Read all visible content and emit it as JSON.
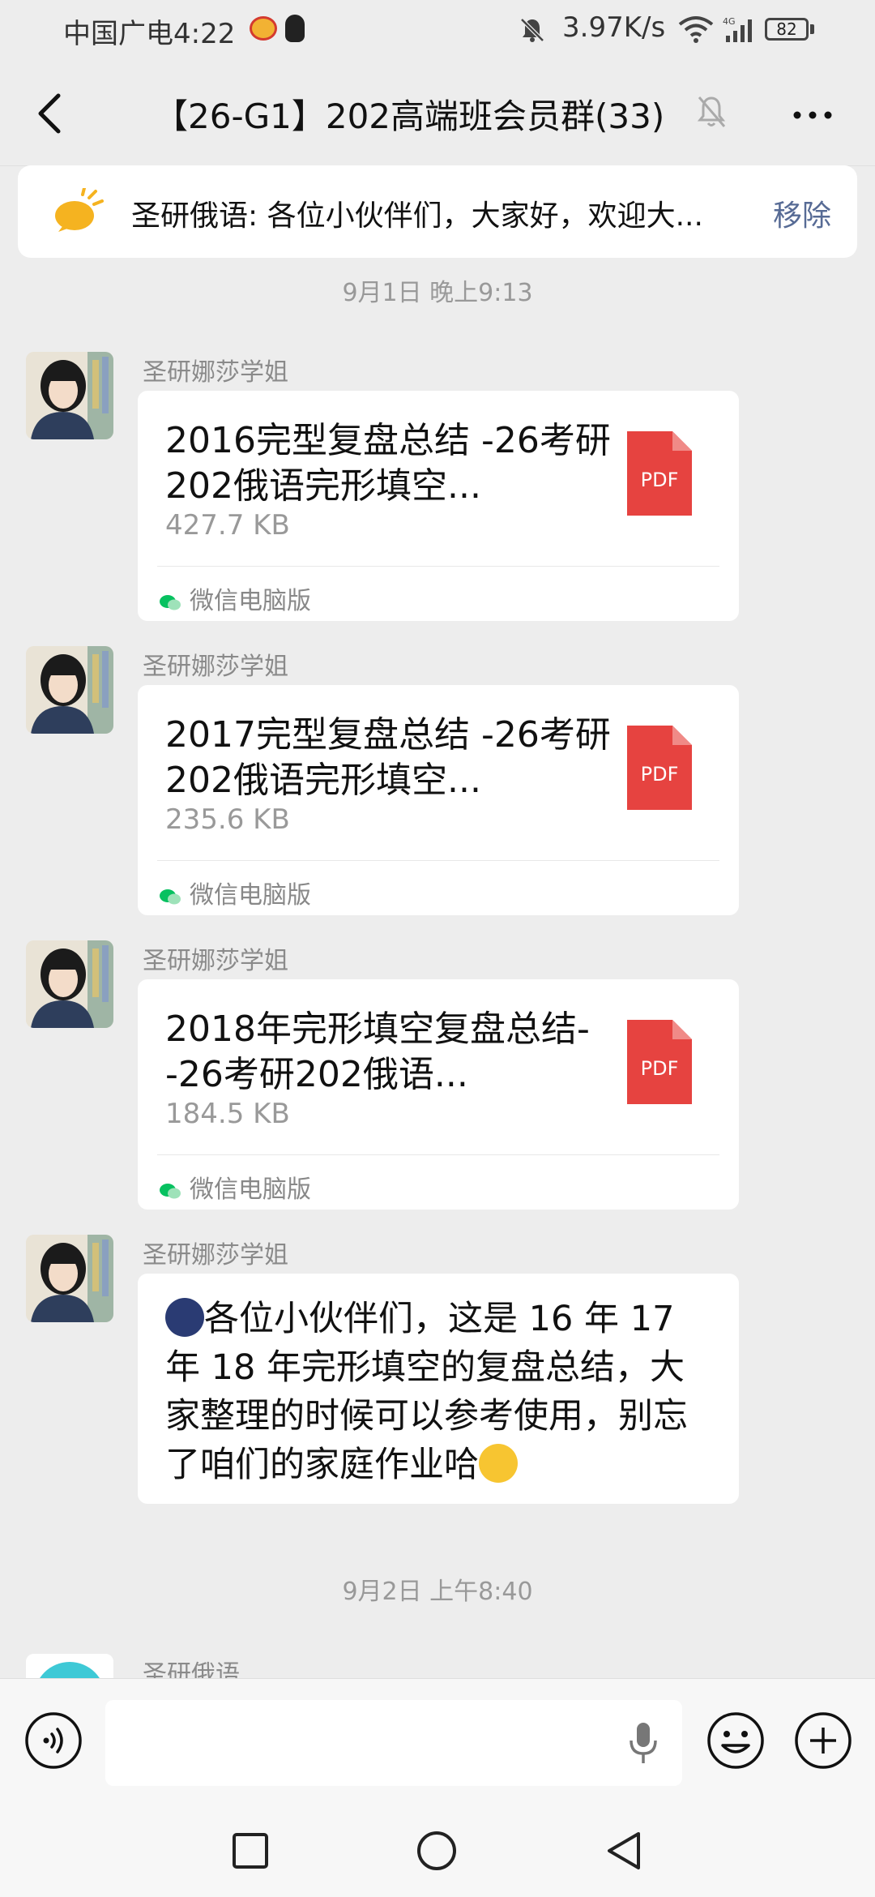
{
  "status_bar": {
    "carrier_time": "中国广电4:22",
    "net_speed": "3.97K/s",
    "battery": "82",
    "network_type": "4G"
  },
  "header": {
    "title": "【26-G1】202高端班会员群(33)",
    "back_icon": "back-chevron-icon",
    "mute_icon": "bell-muted-icon",
    "more_icon": "more-dots-icon"
  },
  "notice": {
    "text": "圣研俄语: 各位小伙伴们，大家好，欢迎大...",
    "remove_label": "移除"
  },
  "timestamps": {
    "first": "9月1日 晚上9:13",
    "second": "9月2日 上午8:40"
  },
  "messages": [
    {
      "sender": "圣研娜莎学姐",
      "file_name": "2016完型复盘总结 -26考研202俄语完形填空...",
      "file_size": "427.7 KB",
      "file_type": "PDF",
      "source": "微信电脑版"
    },
    {
      "sender": "圣研娜莎学姐",
      "file_name": "2017完型复盘总结 -26考研202俄语完形填空...",
      "file_size": "235.6 KB",
      "file_type": "PDF",
      "source": "微信电脑版"
    },
    {
      "sender": "圣研娜莎学姐",
      "file_name": "2018年完形填空复盘总结- -26考研202俄语...",
      "file_size": "184.5 KB",
      "file_type": "PDF",
      "source": "微信电脑版"
    },
    {
      "sender": "圣研娜莎学姐",
      "text": "各位小伙伴们，这是 16 年 17 年 18 年完形填空的复盘总结，大家整理的时候可以参考使用，别忘了咱们的家庭作业哈"
    },
    {
      "sender": "圣研俄语"
    }
  ],
  "colors": {
    "background": "#ededed",
    "link_blue": "#576b95",
    "pdf_red": "#e64340",
    "wechat_green": "#07c160"
  }
}
